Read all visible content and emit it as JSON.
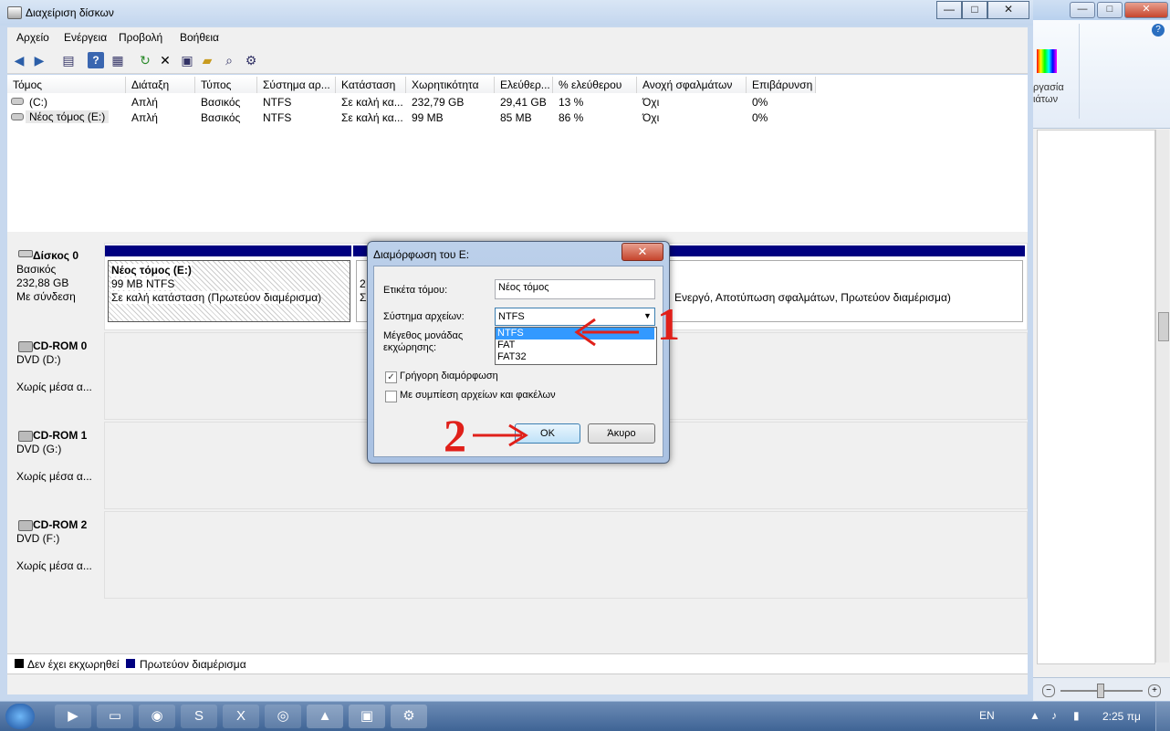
{
  "main_window": {
    "title": "Διαχείριση δίσκων",
    "caption_buttons": {
      "minimize": "—",
      "maximize": "□",
      "close": "✕"
    }
  },
  "menu": [
    "Αρχείο",
    "Ενέργεια",
    "Προβολή",
    "Βοήθεια"
  ],
  "toolbar_icons": [
    "back-icon",
    "forward-icon",
    "console-tree-icon",
    "help-icon",
    "properties-icon",
    "refresh-icon",
    "delete-icon",
    "rescan-icon",
    "open-icon",
    "find-icon",
    "settings-icon"
  ],
  "volume_table": {
    "columns": [
      "Τόμος",
      "Διάταξη",
      "Τύπος",
      "Σύστημα αρ...",
      "Κατάσταση",
      "Χωρητικότητα",
      "Ελεύθερ...",
      "% ελεύθερου",
      "Ανοχή σφαλμάτων",
      "Επιβάρυνση"
    ],
    "rows": [
      [
        "(C:)",
        "Απλή",
        "Βασικός",
        "NTFS",
        "Σε καλή κα...",
        "232,79 GB",
        "29,41 GB",
        "13 %",
        "Όχι",
        "0%"
      ],
      [
        "Νέος τόμος (E:)",
        "Απλή",
        "Βασικός",
        "NTFS",
        "Σε καλή κα...",
        "99 MB",
        "85 MB",
        "86 %",
        "Όχι",
        "0%"
      ]
    ]
  },
  "disks": [
    {
      "name": "Δίσκος 0",
      "type": "Βασικός",
      "size": "232,88 GB",
      "status": "Με σύνδεση"
    },
    {
      "name": "CD-ROM 0",
      "type": "DVD (D:)",
      "size": "",
      "status": "Χωρίς μέσα α..."
    },
    {
      "name": "CD-ROM 1",
      "type": "DVD (G:)",
      "size": "",
      "status": "Χωρίς μέσα α..."
    },
    {
      "name": "CD-ROM 2",
      "type": "DVD (F:)",
      "size": "",
      "status": "Χωρίς μέσα α..."
    }
  ],
  "partition_e": {
    "name": "Νέος τόμος  (E:)",
    "size": "99 MB NTFS",
    "status": "Σε καλή κατάσταση (Πρωτεύον διαμέρισμα)"
  },
  "partition_c": {
    "status_fragment_a": "2",
    "status_fragment_b": "Σ",
    "status": "Ενεργό, Αποτύπωση σφαλμάτων, Πρωτεύον διαμέρισμα)"
  },
  "legend": {
    "unallocated": "Δεν έχει εκχωρηθεί",
    "primary": "Πρωτεύον διαμέρισμα"
  },
  "colors": {
    "primary_partition": "#000080",
    "unallocated": "#000000",
    "annotation_red": "#e0201a"
  },
  "dialog": {
    "title": "Διαμόρφωση του E:",
    "close": "✕",
    "volume_label_label": "Ετικέτα τόμου:",
    "volume_label_value": "Νέος τόμος",
    "filesystem_label": "Σύστημα αρχείων:",
    "filesystem_value": "NTFS",
    "filesystem_options": [
      "NTFS",
      "FAT",
      "FAT32"
    ],
    "alloc_label_1": "Μέγεθος μονάδας",
    "alloc_label_2": "εκχώρησης:",
    "quick_format": "Γρήγορη διαμόρφωση",
    "quick_format_checked": true,
    "compression": "Με συμπίεση αρχείων και φακέλων",
    "compression_checked": false,
    "ok": "OK",
    "cancel": "Άκυρο"
  },
  "annotations": {
    "step1": "1",
    "step2": "2"
  },
  "bg_window": {
    "ribbon_text_1": "ργασία",
    "ribbon_text_2": "ιάτων"
  },
  "taskbar": {
    "language": "EN",
    "time": "2:25 πμ"
  }
}
